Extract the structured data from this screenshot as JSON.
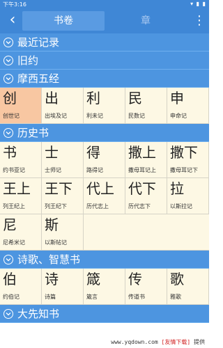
{
  "status": {
    "time": "下午3:16",
    "icons": "▾ ▮ ▮"
  },
  "header": {
    "back": "‹",
    "tab_active": "书卷",
    "tab_inactive": "章",
    "more": "⋮"
  },
  "sections": [
    {
      "title": "最近记录"
    },
    {
      "title": "旧约"
    },
    {
      "title": "摩西五经"
    },
    {
      "title": "历史书"
    },
    {
      "title": "诗歌、智慧书"
    },
    {
      "title": "大先知书"
    }
  ],
  "moses": [
    {
      "big": "创",
      "small": "创世记",
      "selected": true
    },
    {
      "big": "出",
      "small": "出埃及记"
    },
    {
      "big": "利",
      "small": "利未记"
    },
    {
      "big": "民",
      "small": "民数记"
    },
    {
      "big": "申",
      "small": "申命记"
    }
  ],
  "history": [
    {
      "big": "书",
      "small": "约书亚记"
    },
    {
      "big": "士",
      "small": "士师记"
    },
    {
      "big": "得",
      "small": "路得记"
    },
    {
      "big": "撒上",
      "small": "撒母耳记上"
    },
    {
      "big": "撒下",
      "small": "撒母耳记下"
    },
    {
      "big": "王上",
      "small": "列王纪上"
    },
    {
      "big": "王下",
      "small": "列王纪下"
    },
    {
      "big": "代上",
      "small": "历代志上"
    },
    {
      "big": "代下",
      "small": "历代志下"
    },
    {
      "big": "拉",
      "small": "以斯拉记"
    },
    {
      "big": "尼",
      "small": "尼希米记"
    },
    {
      "big": "斯",
      "small": "以斯帖记"
    }
  ],
  "poetry": [
    {
      "big": "伯",
      "small": "约伯记"
    },
    {
      "big": "诗",
      "small": "诗篇"
    },
    {
      "big": "箴",
      "small": "箴言"
    },
    {
      "big": "传",
      "small": "传道书"
    },
    {
      "big": "歌",
      "small": "雅歌"
    }
  ],
  "watermark": {
    "url": "www.yqdown.com",
    "tag": "[友情下载]",
    "suffix": "提供"
  }
}
